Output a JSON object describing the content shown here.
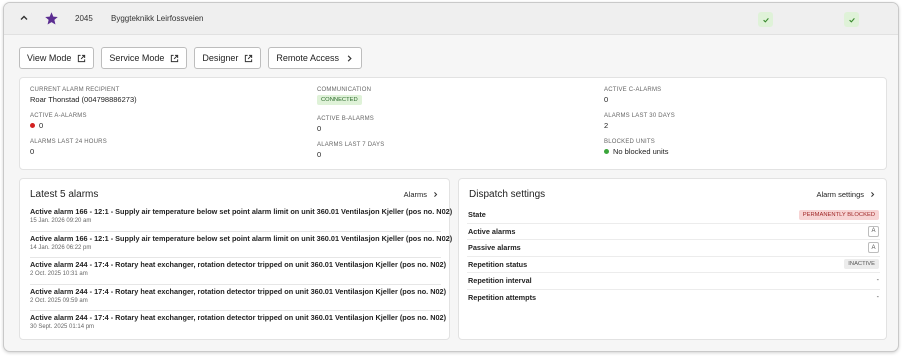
{
  "header": {
    "id": "2045",
    "name": "Byggteknikk Leirfossveien"
  },
  "buttons": {
    "view_mode": "View Mode",
    "service_mode": "Service Mode",
    "designer": "Designer",
    "remote_access": "Remote Access"
  },
  "status": {
    "recipient_label": "Current alarm recipient",
    "recipient_value": "Roar Thonstad (004798886273)",
    "a_alarms_label": "Active A-alarms",
    "a_alarms_value": "0",
    "last24_label": "Alarms last 24 hours",
    "last24_value": "0",
    "communication_label": "Communication",
    "communication_value": "CONNECTED",
    "b_alarms_label": "Active B-alarms",
    "b_alarms_value": "0",
    "last7_label": "Alarms last 7 days",
    "last7_value": "0",
    "c_alarms_label": "Active C-alarms",
    "c_alarms_value": "0",
    "last30_label": "Alarms last 30 days",
    "last30_value": "2",
    "blocked_label": "Blocked units",
    "blocked_value": "No blocked units"
  },
  "alarms": {
    "title": "Latest 5 alarms",
    "link": "Alarms",
    "items": [
      {
        "text": "Active alarm 166 - 12:1 - Supply air temperature below set point alarm limit on unit 360.01 Ventilasjon Kjeller (pos no. N02)",
        "date": "15 Jan. 2026 09:20 am"
      },
      {
        "text": "Active alarm 166 - 12:1 - Supply air temperature below set point alarm limit on unit 360.01 Ventilasjon Kjeller (pos no. N02)",
        "date": "14 Jan. 2026 06:22 pm"
      },
      {
        "text": "Active alarm 244 - 17:4 - Rotary heat exchanger, rotation detector tripped on unit 360.01 Ventilasjon Kjeller (pos no. N02)",
        "date": "2 Oct. 2025 10:31 am"
      },
      {
        "text": "Active alarm 244 - 17:4 - Rotary heat exchanger, rotation detector tripped on unit 360.01 Ventilasjon Kjeller (pos no. N02)",
        "date": "2 Oct. 2025 09:59 am"
      },
      {
        "text": "Active alarm 244 - 17:4 - Rotary heat exchanger, rotation detector tripped on unit 360.01 Ventilasjon Kjeller (pos no. N02)",
        "date": "30 Sept. 2025 01:14 pm"
      }
    ]
  },
  "dispatch": {
    "title": "Dispatch settings",
    "link": "Alarm settings",
    "state_label": "State",
    "state_value": "PERMANENTLY BLOCKED",
    "active_label": "Active alarms",
    "active_value": "A",
    "passive_label": "Passive alarms",
    "passive_value": "A",
    "rep_status_label": "Repetition status",
    "rep_status_value": "INACTIVE",
    "rep_interval_label": "Repetition interval",
    "rep_interval_value": "-",
    "rep_attempts_label": "Repetition attempts",
    "rep_attempts_value": "-"
  },
  "colors": {
    "star": "#5b2d91",
    "check_green": "#3a8a2e",
    "dot_red": "#d32020",
    "dot_green": "#3aa53a"
  },
  "icons": [
    "chevron-up-icon",
    "star-icon",
    "check-icon",
    "external-link-icon",
    "chevron-right-icon"
  ]
}
